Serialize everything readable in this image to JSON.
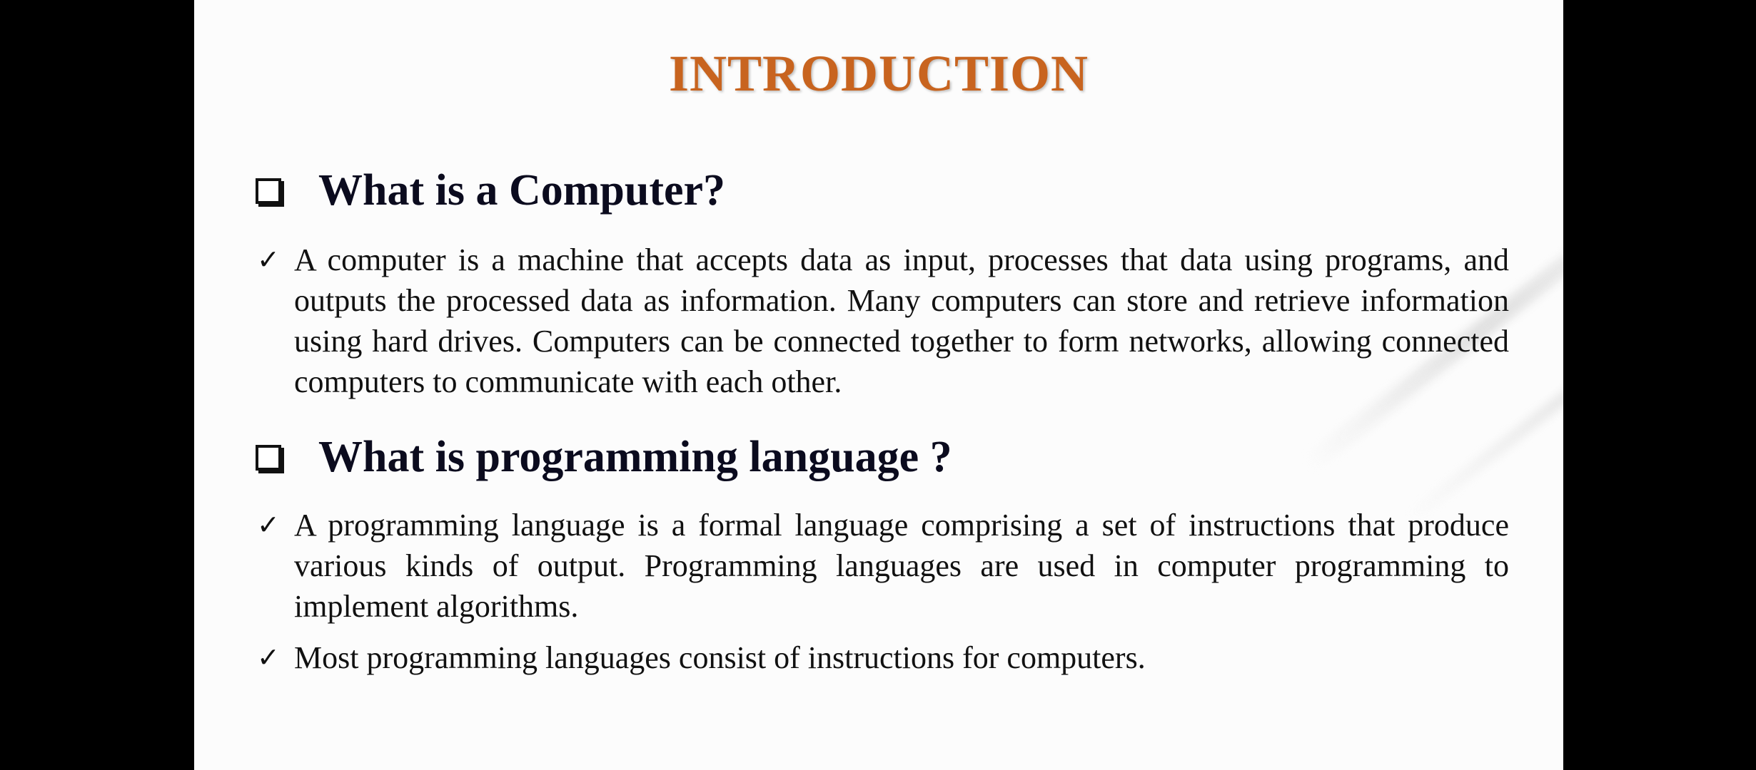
{
  "slide": {
    "title": "INTRODUCTION",
    "title_color": "#c8641f",
    "sections": [
      {
        "heading": "What is a Computer?",
        "icon": "checkbox-square-icon",
        "bullets": [
          "A computer is a machine that accepts data as input, processes that data using programs, and outputs the processed data as information. Many computers can store and retrieve information using hard drives. Computers can be connected together to form networks, allowing connected computers to communicate with each other."
        ]
      },
      {
        "heading": "What is programming language ?",
        "icon": "checkbox-square-icon",
        "bullets": [
          "A programming language is a formal language comprising a set of instructions that produce various kinds of output. Programming languages are used in computer programming to implement algorithms.",
          "Most programming languages consist of instructions for computers."
        ]
      }
    ],
    "bullet_mark": "✓"
  }
}
